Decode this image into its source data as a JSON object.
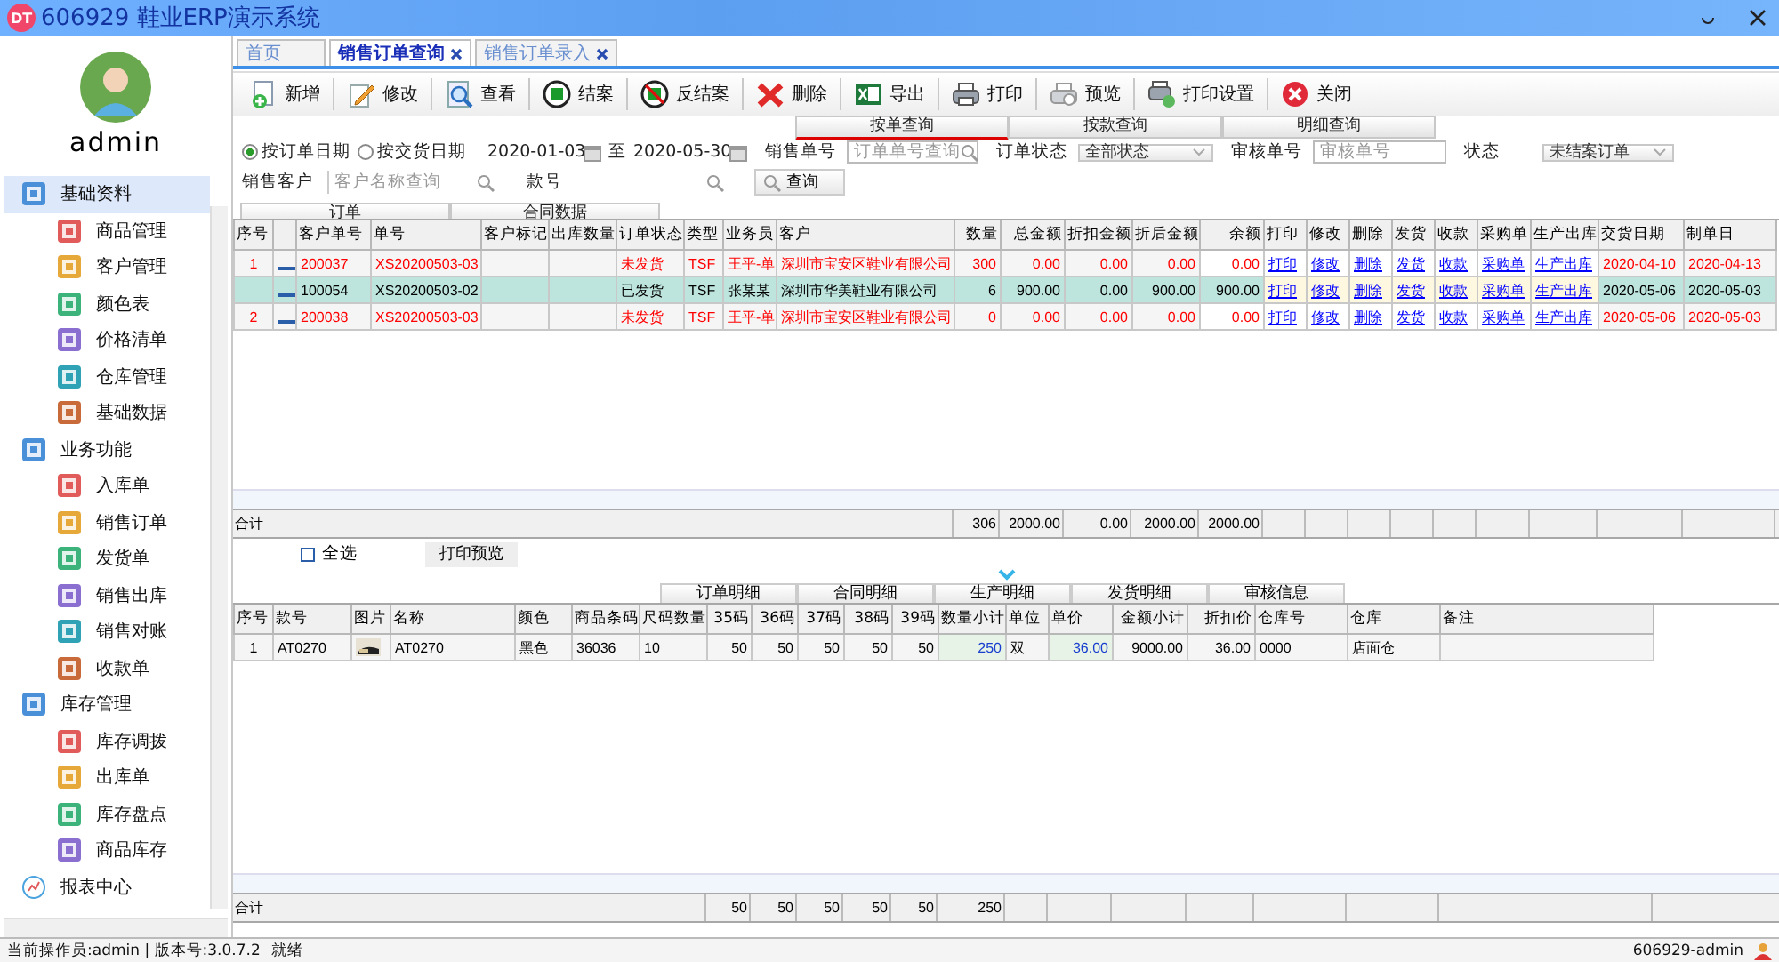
{
  "window": {
    "logo": "DT",
    "title": "606929 鞋业ERP演示系统"
  },
  "sidebar": {
    "user": "admin",
    "groups": [
      {
        "label": "基础资料",
        "selected": true,
        "children": [
          {
            "label": "商品管理",
            "selected": false
          },
          {
            "label": "客户管理",
            "selected": false
          },
          {
            "label": "颜色表",
            "selected": false
          },
          {
            "label": "价格清单",
            "selected": false
          },
          {
            "label": "仓库管理",
            "selected": false
          },
          {
            "label": "基础数据",
            "selected": false
          }
        ]
      },
      {
        "label": "业务功能",
        "selected": false,
        "children": [
          {
            "label": "入库单",
            "selected": false
          },
          {
            "label": "销售订单",
            "selected": false
          },
          {
            "label": "发货单",
            "selected": false
          },
          {
            "label": "销售出库",
            "selected": false
          },
          {
            "label": "销售对账",
            "selected": false
          },
          {
            "label": "收款单",
            "selected": false
          }
        ]
      },
      {
        "label": "库存管理",
        "selected": false,
        "children": [
          {
            "label": "库存调拨",
            "selected": false
          },
          {
            "label": "出库单",
            "selected": false
          },
          {
            "label": "库存盘点",
            "selected": false
          },
          {
            "label": "商品库存",
            "selected": false
          }
        ]
      }
    ],
    "report_item": {
      "label": "报表中心",
      "selected": false
    }
  },
  "tabs": [
    {
      "label": "首页",
      "selected": false,
      "closable": false
    },
    {
      "label": "销售订单查询",
      "selected": true,
      "closable": true
    },
    {
      "label": "销售订单录入",
      "selected": false,
      "closable": true
    }
  ],
  "toolbar": [
    "新增",
    "修改",
    "查看",
    "结案",
    "反结案",
    "删除",
    "导出",
    "打印",
    "预览",
    "打印设置",
    "关闭"
  ],
  "filters": {
    "tabs": [
      {
        "label": "按单查询",
        "selected": true
      },
      {
        "label": "按款查询",
        "selected": false
      },
      {
        "label": "明细查询",
        "selected": false
      }
    ],
    "date_modes": [
      {
        "label": "按订单日期",
        "selected": true
      },
      {
        "label": "按交货日期",
        "selected": false
      }
    ],
    "date_from": "2020-01-03",
    "to_label": "至",
    "date_to": "2020-05-30",
    "fields": [
      {
        "kind": "search",
        "label": "销售单号",
        "placeholder": "订单单号查询"
      },
      {
        "kind": "select",
        "label": "订单状态",
        "value": "全部状态"
      },
      {
        "kind": "text",
        "label": "审核单号",
        "placeholder": "审核单号"
      },
      {
        "kind": "select",
        "label": "状态",
        "value": "未结案订单"
      }
    ],
    "customer": {
      "label": "销售客户",
      "placeholder": "客户名称查询"
    },
    "style_no": {
      "label": "款号"
    },
    "query_button": "查询",
    "view_tabs": [
      {
        "label": "订单",
        "selected": true
      },
      {
        "label": "合同数据",
        "selected": false
      }
    ]
  },
  "orders": {
    "columns": [
      {
        "label": "序号",
        "kind": "center"
      },
      {
        "kind": "check"
      },
      {
        "label": "客户单号",
        "kind": "text"
      },
      {
        "label": "单号",
        "kind": "text"
      },
      {
        "label": "客户标记",
        "kind": "text"
      },
      {
        "label": "出库数量",
        "kind": "text"
      },
      {
        "label": "订单状态",
        "kind": "text"
      },
      {
        "label": "类型",
        "kind": "text"
      },
      {
        "label": "业务员",
        "kind": "text"
      },
      {
        "label": "客户",
        "kind": "text"
      },
      {
        "label": "数量",
        "kind": "num"
      },
      {
        "label": "总金额",
        "kind": "num"
      },
      {
        "label": "折扣金额",
        "kind": "num"
      },
      {
        "label": "折后金额",
        "kind": "num"
      },
      {
        "label": "余额",
        "kind": "num"
      },
      {
        "label": "打印",
        "kind": "link"
      },
      {
        "label": "修改",
        "kind": "link"
      },
      {
        "label": "删除",
        "kind": "link"
      },
      {
        "label": "发货",
        "kind": "link"
      },
      {
        "label": "收款",
        "kind": "link"
      },
      {
        "label": "采购单",
        "kind": "link"
      },
      {
        "label": "生产出库",
        "kind": "link"
      },
      {
        "label": "交货日期",
        "kind": "text"
      },
      {
        "label": "制单日",
        "kind": "text"
      }
    ],
    "rows": [
      {
        "selected": false,
        "overdue": true,
        "checked": false,
        "cells": {
          "no": "1",
          "customer_no": "200037",
          "order_no": "XS20200503-03",
          "status": "未发货",
          "type": "TSF",
          "salesman": "王平-单",
          "customer": "深圳市宝安区鞋业有限公司",
          "qty": "300",
          "amount": "0.00",
          "discount": "0.00",
          "net_amount": "0.00",
          "balance": "0.00",
          "print": "打印",
          "edit": "修改",
          "delete": "删除",
          "ship": "发货",
          "receipt": "收款",
          "purchase": "采购单",
          "production": "生产出库",
          "delivery_date": "2020-04-10",
          "created_date": "2020-04-13"
        }
      },
      {
        "selected": true,
        "overdue": false,
        "checked": false,
        "cells": {
          "customer_no": "100054",
          "order_no": "XS20200503-02",
          "status": "已发货",
          "type": "TSF",
          "salesman": "张某某",
          "customer": "深圳市华美鞋业有限公司",
          "qty": "6",
          "amount": "900.00",
          "discount": "0.00",
          "net_amount": "900.00",
          "balance": "900.00",
          "print": "打印",
          "edit": "修改",
          "delete": "删除",
          "ship": "发货",
          "receipt": "收款",
          "purchase": "采购单",
          "production": "生产出库",
          "delivery_date": "2020-05-06",
          "created_date": "2020-05-03"
        }
      },
      {
        "selected": false,
        "overdue": true,
        "checked": false,
        "cells": {
          "no": "2",
          "customer_no": "200038",
          "order_no": "XS20200503-03",
          "status": "未发货",
          "type": "TSF",
          "salesman": "王平-单",
          "customer": "深圳市宝安区鞋业有限公司",
          "qty": "0",
          "amount": "0.00",
          "discount": "0.00",
          "net_amount": "0.00",
          "balance": "0.00",
          "print": "打印",
          "edit": "修改",
          "delete": "删除",
          "ship": "发货",
          "receipt": "收款",
          "purchase": "采购单",
          "production": "生产出库",
          "delivery_date": "2020-05-06",
          "created_date": "2020-05-03"
        }
      }
    ],
    "footer": {
      "label": "合计",
      "values": {
        "qty": "306",
        "amount": "2000.00",
        "discount": "0.00",
        "net_amount": "2000.00",
        "balance": "2000.00"
      }
    }
  },
  "select_all": {
    "label": "全选",
    "checked": false
  },
  "print_button": "打印预览",
  "detail_tabs": [
    {
      "label": "订单明细",
      "selected": true
    },
    {
      "label": "合同明细",
      "selected": false
    },
    {
      "label": "生产明细",
      "selected": false
    },
    {
      "label": "发货明细",
      "selected": false
    },
    {
      "label": "审核信息",
      "selected": false
    }
  ],
  "details": {
    "columns": [
      {
        "label": "序号",
        "kind": "center"
      },
      {
        "label": "款号",
        "kind": "text"
      },
      {
        "label": "图片"
      },
      {
        "label": "名称",
        "kind": "text"
      },
      {
        "label": "颜色",
        "kind": "text"
      },
      {
        "label": "商品条码",
        "kind": "text"
      },
      {
        "label": "尺码数量",
        "kind": "text"
      },
      {
        "label": "35码",
        "kind": "num"
      },
      {
        "label": "36码",
        "kind": "num"
      },
      {
        "label": "37码",
        "kind": "num"
      },
      {
        "label": "38码",
        "kind": "num"
      },
      {
        "label": "39码",
        "kind": "num"
      },
      {
        "label": "数量小计",
        "kind": "edit"
      },
      {
        "label": "单位",
        "kind": "text"
      },
      {
        "label": "单价",
        "kind": "edit"
      },
      {
        "label": "金额小计",
        "kind": "num"
      },
      {
        "label": "折扣价",
        "kind": "num"
      },
      {
        "label": "仓库号",
        "kind": "text"
      },
      {
        "label": "仓库",
        "kind": "text"
      },
      {
        "label": "备注",
        "kind": "text"
      }
    ],
    "rows": [
      {
        "selected": false,
        "overdue": false,
        "cells": {
          "no": "1",
          "style": "AT0270",
          "name": "AT0270",
          "color_name": "黑色",
          "barcode": "36036",
          "size_qty": "10",
          "s35": "50",
          "s36": "50",
          "s37": "50",
          "s38": "50",
          "s39": "50",
          "qty_total": "250",
          "unit": "双",
          "price": "36.00",
          "amount_total": "9000.00",
          "discount_price": "36.00",
          "warehouse_no": "0000",
          "warehouse": "店面仓"
        }
      }
    ],
    "footer": {
      "label": "合计",
      "values": {
        "s35": "50",
        "s36": "50",
        "s37": "50",
        "s38": "50",
        "s39": "50",
        "qty_total": "250"
      }
    }
  },
  "status_bar": {
    "left": "当前操作员:admin | 版本号:3.0.7.2",
    "state": "就绪",
    "right": "606929-admin"
  }
}
